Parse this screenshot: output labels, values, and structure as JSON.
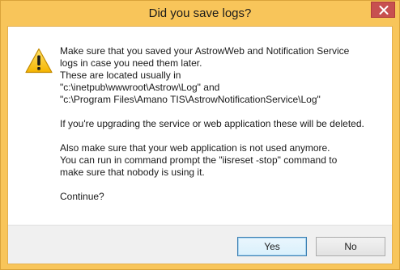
{
  "window": {
    "title": "Did you save logs?",
    "close_icon": "close-icon"
  },
  "dialog": {
    "icon": "warning-icon",
    "message_lines": [
      "Make sure that you saved your AstrowWeb and Notification Service",
      "logs in case you need them later.",
      "These are located usually in",
      "\"c:\\inetpub\\wwwroot\\Astrow\\Log\" and",
      "\"c:\\Program Files\\Amano TIS\\AstrowNotificationService\\Log\"",
      "",
      "If you're upgrading the service or web application these will be deleted.",
      "",
      "Also make sure that your web application is not used anymore.",
      "You can run in command prompt the \"iisreset -stop\" command to",
      "make sure that nobody is using it.",
      "",
      "Continue?"
    ]
  },
  "buttons": {
    "yes_label": "Yes",
    "no_label": "No"
  },
  "colors": {
    "frame": "#f8c55a",
    "close_button": "#c75050",
    "footer": "#f0f0f0",
    "default_button_border": "#3c7fb1"
  }
}
